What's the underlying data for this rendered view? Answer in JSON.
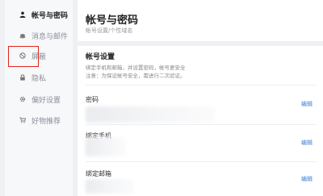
{
  "sidebar": {
    "items": [
      {
        "label": "帐号与密码",
        "icon": "user-icon",
        "active": true
      },
      {
        "label": "消息与邮件",
        "icon": "bell-icon",
        "active": false
      },
      {
        "label": "屏蔽",
        "icon": "block-icon",
        "active": false
      },
      {
        "label": "隐私",
        "icon": "lock-icon",
        "active": false
      },
      {
        "label": "偏好设置",
        "icon": "gear-icon",
        "active": false
      },
      {
        "label": "好物推荐",
        "icon": "cart-icon",
        "active": false
      }
    ]
  },
  "main": {
    "title": "帐号与密码",
    "subtitle": "帐号设置/个性域名",
    "section": {
      "title": "帐号设置",
      "desc_line1": "绑定手机和邮箱，并设置密码，帐号更安全",
      "desc_line2": "注意：为保证帐号安全，需进行二次验证。"
    },
    "rows": [
      {
        "label": "密码",
        "action": "编辑"
      },
      {
        "label": "绑定手机",
        "action": "编辑"
      },
      {
        "label": "绑定邮箱",
        "action": "编辑"
      }
    ]
  },
  "colors": {
    "highlight": "#e3251f",
    "link": "#3e7fd8",
    "sidebar_bg": "#f7f8fa",
    "page_bg": "#eef0f3"
  }
}
